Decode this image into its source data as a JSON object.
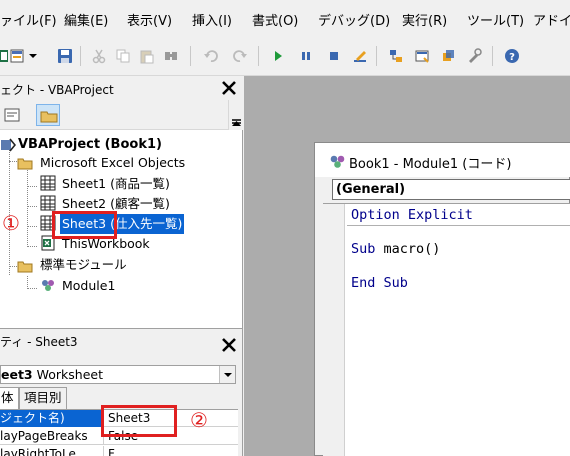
{
  "menu": {
    "items": [
      "ァイル(F)",
      "編集(E)",
      "表示(V)",
      "挿入(I)",
      "書式(O)",
      "デバッグ(D)",
      "実行(R)",
      "ツール(T)",
      "アドイ"
    ]
  },
  "toolbar": {
    "icons": [
      "excel-icon",
      "insert-module-icon",
      "save-icon",
      "cut-icon",
      "copy-icon",
      "paste-icon",
      "find-icon",
      "undo-icon",
      "redo-icon",
      "run-icon",
      "break-icon",
      "reset-icon",
      "design-mode-icon",
      "project-explorer-icon",
      "properties-icon",
      "object-browser-icon",
      "toolbox-icon",
      "help-icon"
    ]
  },
  "project_explorer": {
    "title": "ェクト - VBAProject",
    "tree": {
      "root": "VBAProject (Book1)",
      "folder_objects": "Microsoft Excel Objects",
      "sheet1": "Sheet1 (商品一覧)",
      "sheet2": "Sheet2 (顧客一覧)",
      "sheet3_name": "Sheet3",
      "sheet3_caption": " (仕入先一覧)",
      "workbook": "ThisWorkbook",
      "folder_modules": "標準モジュール",
      "module1": "Module1"
    }
  },
  "annotations": {
    "marker1": "①",
    "marker2": "②"
  },
  "properties": {
    "title": "ティ - Sheet3",
    "object_bold": "eet3",
    "object_type": " Worksheet",
    "tabs": [
      "体",
      "項目別"
    ],
    "rows": [
      {
        "name": "ジェクト名)",
        "value": "Sheet3"
      },
      {
        "name": "layPageBreaks",
        "value": "False"
      },
      {
        "name": "layRightToLe",
        "value": "F..."
      }
    ]
  },
  "code_window": {
    "title": "Book1 - Module1 (コード)",
    "object_combo": "(General)",
    "lines": {
      "option": "Option Explicit",
      "sub_kw": "Sub",
      "sub_rest": " macro()",
      "end": "End Sub"
    }
  },
  "colors": {
    "selection": "#0a64d2",
    "annotation": "#e02020",
    "keyword": "#00008b",
    "mdi_bg": "#acacac"
  }
}
